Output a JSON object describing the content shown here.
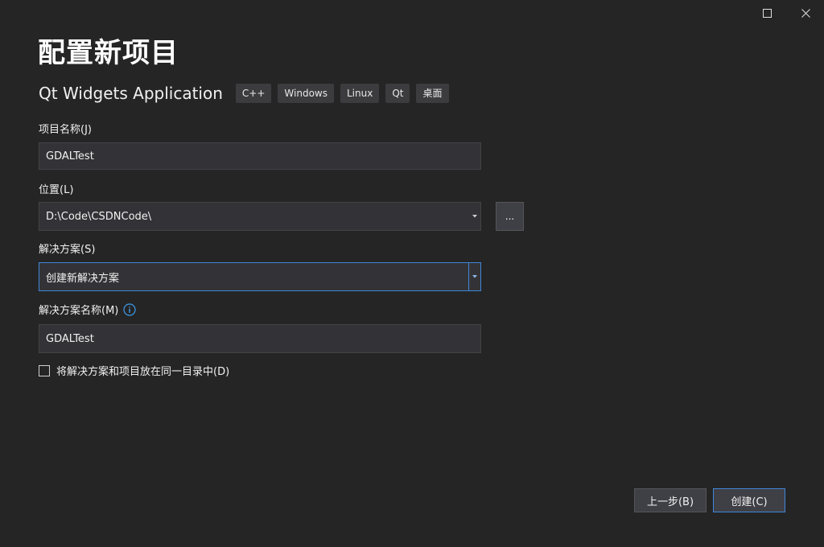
{
  "title": "配置新项目",
  "template": {
    "name": "Qt Widgets Application",
    "tags": [
      "C++",
      "Windows",
      "Linux",
      "Qt",
      "桌面"
    ]
  },
  "project_name": {
    "label": "项目名称(J)",
    "value": "GDALTest"
  },
  "location": {
    "label": "位置(L)",
    "value": "D:\\Code\\CSDNCode\\",
    "browse_label": "..."
  },
  "solution": {
    "label": "解决方案(S)",
    "value": "创建新解决方案"
  },
  "solution_name": {
    "label": "解决方案名称(M)",
    "value": "GDALTest"
  },
  "same_dir": {
    "label": "将解决方案和项目放在同一目录中(D)",
    "checked": false
  },
  "buttons": {
    "back": "上一步(B)",
    "create": "创建(C)"
  },
  "colors": {
    "background": "#252526",
    "field": "#333337",
    "accent": "#3f87d6"
  }
}
